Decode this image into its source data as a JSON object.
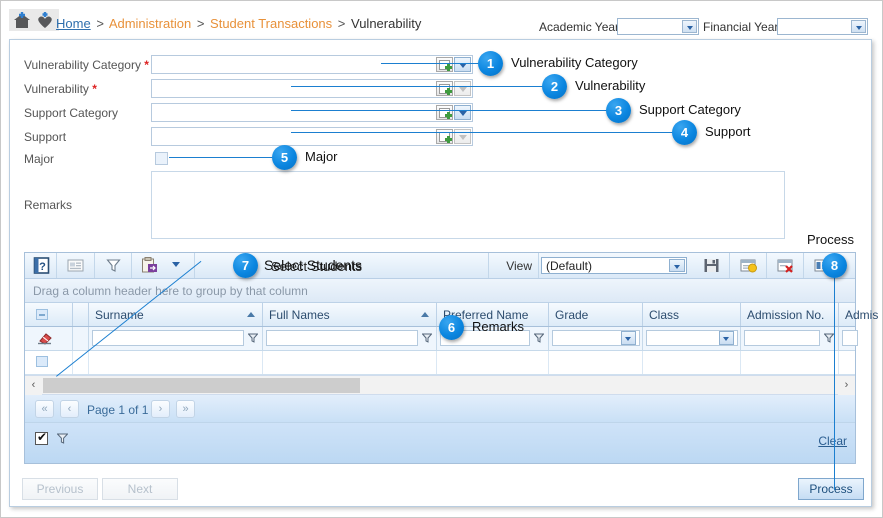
{
  "breadcrumb": {
    "home": "Home",
    "sep": ">",
    "administration": "Administration",
    "student_transactions": "Student Transactions",
    "current": "Vulnerability",
    "home_icon": "home-icon",
    "heart_icon": "heart-icon"
  },
  "header": {
    "academic_year_label": "Academic Year",
    "academic_year_value": "",
    "financial_year_label": "Financial Year",
    "financial_year_value": ""
  },
  "form": {
    "fields": [
      {
        "label": "Vulnerability Category",
        "required": true,
        "value": "",
        "dropdown_enabled": true
      },
      {
        "label": "Vulnerability",
        "required": true,
        "value": "",
        "dropdown_enabled": false
      },
      {
        "label": "Support Category",
        "required": false,
        "value": "",
        "dropdown_enabled": true
      },
      {
        "label": "Support",
        "required": false,
        "value": "",
        "dropdown_enabled": false
      }
    ],
    "major_label": "Major",
    "major_checked": false,
    "remarks_label": "Remarks",
    "remarks_value": ""
  },
  "grid": {
    "title": "Select Students",
    "view_label": "View",
    "view_value": "(Default)",
    "group_hint": "Drag a column header here to group by that column",
    "toolbar_icons": [
      "help-icon",
      "card-view-icon",
      "filter-icon",
      "export-icon",
      "chevron-down-icon"
    ],
    "right_icons": [
      "save-icon",
      "new-view-icon",
      "delete-view-icon",
      "column-chooser-icon"
    ],
    "columns": [
      {
        "label": "Surname",
        "sorted": true,
        "filter": "text"
      },
      {
        "label": "Full Names",
        "sorted": true,
        "filter": "text"
      },
      {
        "label": "Preferred Name",
        "sorted": false,
        "filter": "text"
      },
      {
        "label": "Grade",
        "sorted": false,
        "filter": "select"
      },
      {
        "label": "Class",
        "sorted": false,
        "filter": "select"
      },
      {
        "label": "Admission No.",
        "sorted": false,
        "filter": "text"
      },
      {
        "label": "Admis",
        "sorted": false,
        "filter": "text"
      }
    ],
    "pager": {
      "first": "«",
      "prev": "‹",
      "text": "Page 1 of 1",
      "next": "›",
      "last": "»"
    },
    "footer": {
      "select_all_checked": true,
      "filter_icon": "filter-icon",
      "clear_label": "Clear"
    },
    "scroll_left": "‹",
    "scroll_right": "›"
  },
  "footer": {
    "previous_label": "Previous",
    "next_label": "Next",
    "process_label": "Process"
  },
  "callouts": [
    {
      "n": "1",
      "label": "Vulnerability Category"
    },
    {
      "n": "2",
      "label": "Vulnerability"
    },
    {
      "n": "3",
      "label": "Support Category"
    },
    {
      "n": "4",
      "label": "Support"
    },
    {
      "n": "5",
      "label": "Major"
    },
    {
      "n": "6",
      "label": "Remarks"
    },
    {
      "n": "7",
      "label": "Select Students"
    },
    {
      "n": "8",
      "label": "Process"
    }
  ],
  "colors": {
    "accent": "#0b86e0",
    "link": "#2f6fad",
    "crumb": "#e8913a",
    "required": "#d22222"
  }
}
